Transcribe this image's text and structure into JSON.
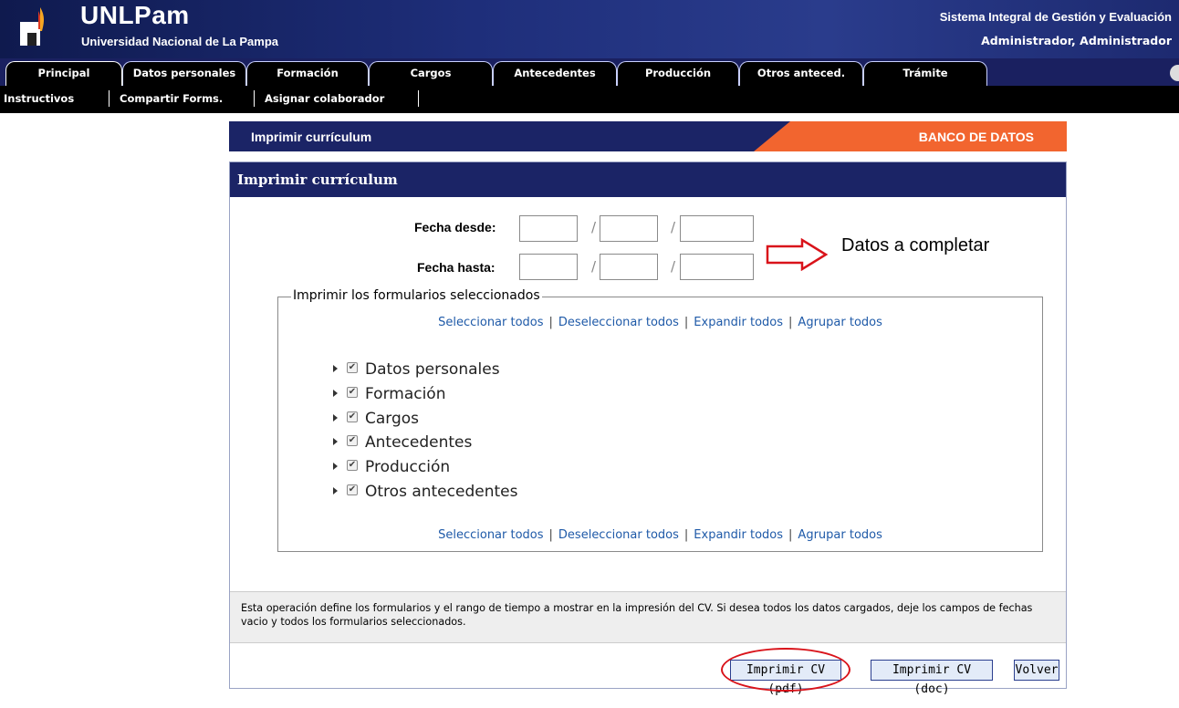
{
  "header": {
    "brand_title": "UNLPam",
    "brand_subtitle": "Universidad Nacional de La Pampa",
    "system_title": "Sistema Integral de Gestión y Evaluación",
    "user": "Administrador, Administrador"
  },
  "tabs": [
    {
      "label": "Principal",
      "active": true
    },
    {
      "label": "Datos personales"
    },
    {
      "label": "Formación"
    },
    {
      "label": "Cargos"
    },
    {
      "label": "Antecedentes"
    },
    {
      "label": "Producción"
    },
    {
      "label": "Otros anteced."
    },
    {
      "label": "Trámite"
    }
  ],
  "subnav": [
    "Instructivos",
    "Compartir Forms.",
    "Asignar colaborador"
  ],
  "banner": {
    "title": "Imprimir currículum",
    "right": "BANCO DE DATOS"
  },
  "panel": {
    "title": "Imprimir currículum",
    "fecha_desde_label": "Fecha desde:",
    "fecha_hasta_label": "Fecha hasta:",
    "date_separator": "/",
    "annotation": "Datos a completar",
    "fieldset_legend": "Imprimir los formularios seleccionados",
    "links": [
      "Seleccionar todos",
      "Deseleccionar todos",
      "Expandir todos",
      "Agrupar todos"
    ],
    "forms": [
      {
        "label": "Datos personales",
        "checked": true
      },
      {
        "label": "Formación",
        "checked": true
      },
      {
        "label": "Cargos",
        "checked": true
      },
      {
        "label": "Antecedentes",
        "checked": true
      },
      {
        "label": "Producción",
        "checked": true
      },
      {
        "label": "Otros antecedentes",
        "checked": true
      }
    ],
    "info_text": "Esta operación define los formularios y el rango de tiempo a mostrar en la impresión del CV. Si desea todos los datos cargados, deje los campos de fechas vacio y todos los formularios seleccionados.",
    "buttons": {
      "pdf": "Imprimir CV (pdf)",
      "doc": "Imprimir CV (doc)",
      "back": "Volver"
    }
  },
  "colors": {
    "navy": "#1b2466",
    "orange": "#f2652f",
    "link": "#1f5aa8",
    "highlight": "#d9131a"
  }
}
